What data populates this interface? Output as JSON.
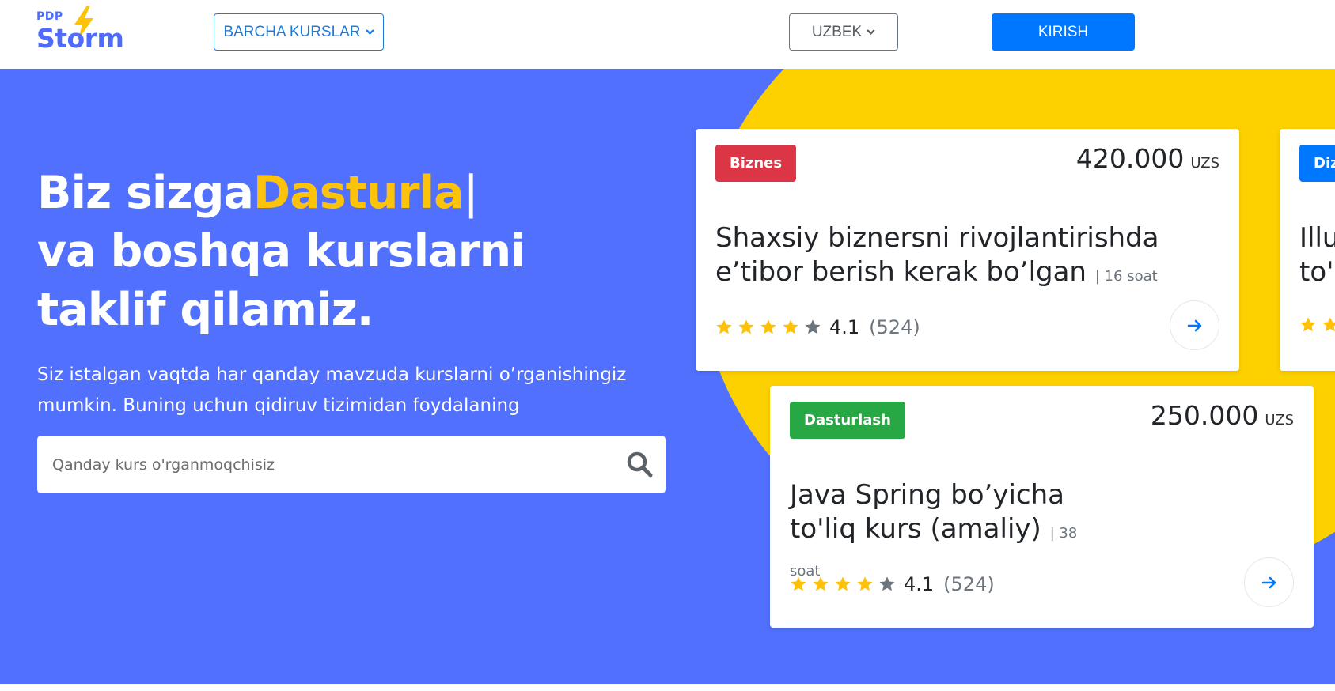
{
  "header": {
    "logo": {
      "small": "PDP",
      "large": "Storm"
    },
    "courses_button": "BARCHA KURSLAR",
    "language_button": "UZBEK",
    "login_button": "KIRISH"
  },
  "hero": {
    "headline_start": "Biz sizga",
    "headline_typed": "Dasturla",
    "headline_cursor": "|",
    "headline_rest": "va boshqa kurslarni taklif qilamiz.",
    "subtitle": "Siz istalgan vaqtda har qanday mavzuda kurslarni o’rganishingiz mumkin. Buning uchun qidiruv tizimidan foydalaning",
    "search": {
      "placeholder": "Qanday kurs o'rganmoqchisiz"
    }
  },
  "cards": [
    {
      "category": "Biznes",
      "category_color": "#dc3545",
      "price": "420.000",
      "currency": "UZS",
      "title": "Shaxsiy biznersni rivojlantirishda e’tibor berish kerak bo’lgan",
      "hours": "| 16 soat",
      "stars_filled": 4,
      "stars_total": 5,
      "rating": "4.1",
      "reviews": "(524)"
    },
    {
      "category": "Dasturlash",
      "category_color": "#28a745",
      "price": "250.000",
      "currency": "UZS",
      "title": "Java Spring bo’yicha to'liq kurs (amaliy)",
      "hours": "| 38 soat",
      "stars_filled": 4,
      "stars_total": 5,
      "rating": "4.1",
      "reviews": "(524)"
    },
    {
      "category": "Diz",
      "category_color": "#0077ff",
      "title": "Illu to'l",
      "stars_filled": 2
    }
  ],
  "colors": {
    "hero_bg": "#5170fd",
    "accent_yellow": "#fdd100",
    "typed_text": "#fdc20a",
    "primary": "#0077ff",
    "star_filled": "#ffc107",
    "star_empty": "#6c757d"
  }
}
